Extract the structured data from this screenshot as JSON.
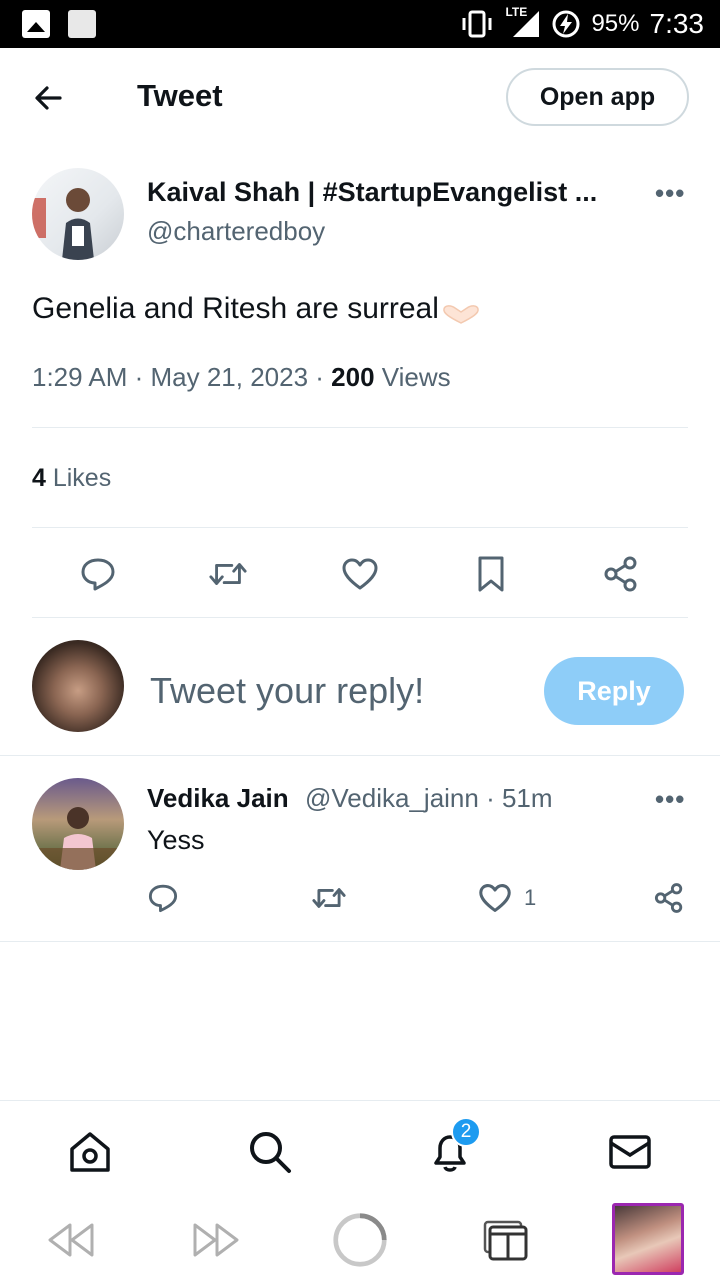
{
  "status_bar": {
    "network": "LTE",
    "battery": "95%",
    "time": "7:33"
  },
  "header": {
    "title": "Tweet",
    "open_app_label": "Open app"
  },
  "tweet": {
    "author_name": "Kaival Shah | #StartupEvangelist ...",
    "author_handle": "@charteredboy",
    "text": "Genelia and Ritesh are surreal",
    "timestamp": "1:29 AM · May 21, 2023 · ",
    "views_count": "200",
    "views_label": " Views",
    "likes_count": "4",
    "likes_label": " Likes"
  },
  "reply_box": {
    "placeholder": "Tweet your reply!",
    "button_label": "Reply"
  },
  "reply": {
    "author_name": "Vedika Jain",
    "meta": "@Vedika_jainn · 51m",
    "text": "Yess",
    "like_count": "1"
  },
  "bottom_nav": {
    "notifications_badge": "2"
  },
  "colors": {
    "accent": "#1d9bf0",
    "reply_button": "#8ecdf8",
    "secondary_text": "#536471",
    "tab_thumb_border": "#9b27b0"
  }
}
